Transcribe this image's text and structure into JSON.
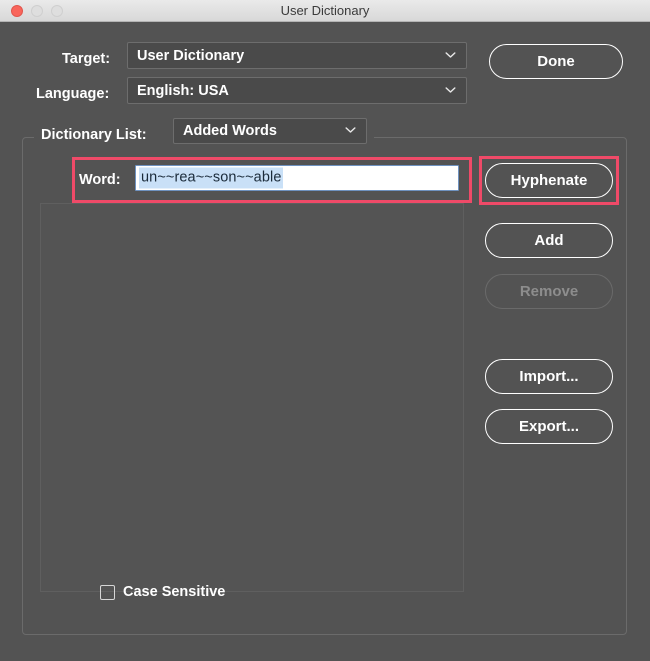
{
  "window": {
    "title": "User Dictionary",
    "traffic_lights": [
      {
        "name": "close",
        "color": "#f9655b"
      },
      {
        "name": "minimize",
        "color": "#dedede"
      },
      {
        "name": "zoom",
        "color": "#dedede"
      }
    ]
  },
  "form": {
    "target": {
      "label": "Target:",
      "value": "User Dictionary",
      "icon": "chevron-down-icon"
    },
    "language": {
      "label": "Language:",
      "value": "English: USA",
      "icon": "chevron-down-icon"
    },
    "dictionary_list": {
      "label": "Dictionary List:",
      "value": "Added Words",
      "icon": "chevron-down-icon"
    },
    "word": {
      "label": "Word:",
      "value": "un~~rea~~son~~able",
      "placeholder": "",
      "selected": true
    },
    "case_sensitive": {
      "label": "Case Sensitive",
      "checked": false
    },
    "word_list": {
      "items": []
    }
  },
  "buttons": {
    "done": {
      "label": "Done",
      "enabled": true
    },
    "hyphenate": {
      "label": "Hyphenate",
      "enabled": true
    },
    "add": {
      "label": "Add",
      "enabled": true
    },
    "remove": {
      "label": "Remove",
      "enabled": false
    },
    "import": {
      "label": "Import...",
      "enabled": true
    },
    "export": {
      "label": "Export...",
      "enabled": true
    }
  },
  "annotations": {
    "highlight_color": "#ef4a68",
    "regions": [
      {
        "name": "word-field-highlight"
      },
      {
        "name": "hyphenate-button-highlight"
      }
    ]
  },
  "colors": {
    "dialog_background": "#535353",
    "titlebar_background": "#e4e4e4",
    "field_background": "#4a4a4a",
    "text": "#ffffff",
    "disabled_text": "#8d8d8d",
    "selection_background": "#c9e0f7",
    "input_background": "#ffffff",
    "accent_highlight": "#ef4a68"
  }
}
